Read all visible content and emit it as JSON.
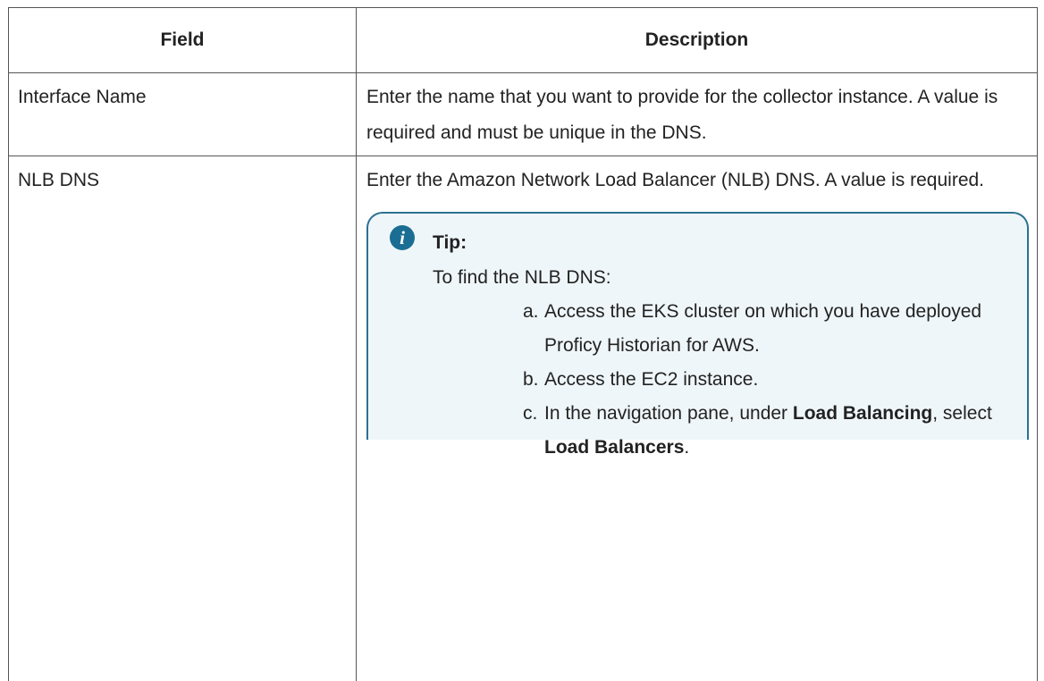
{
  "table": {
    "headers": {
      "field": "Field",
      "description": "Description"
    },
    "rows": [
      {
        "field": "Interface Name",
        "description": "Enter the name that you want to provide for the collector in­stance. A value is required and must be unique in the DNS."
      },
      {
        "field": "NLB DNS",
        "description": "Enter the Amazon Network Load Balancer (NLB) DNS. A value is required.",
        "tip": {
          "icon": "info-icon",
          "icon_glyph": "i",
          "title": "Tip:",
          "intro": "To find the NLB DNS:",
          "steps": [
            {
              "marker": "a.",
              "text": "Access the EKS cluster on which you have de­ployed Proficy Historian for AWS."
            },
            {
              "marker": "b.",
              "text": "Access the EC2 instance."
            },
            {
              "marker": "c.",
              "text_before": "In the navigation pane, under ",
              "bold_1": "Load Balancing",
              "text_middle": ", se­lect ",
              "bold_2": "Load Balancers",
              "text_after": "."
            }
          ]
        }
      }
    ]
  },
  "colors": {
    "tip_border": "#2c7191",
    "tip_background": "#eff6f9",
    "icon_background": "#1b6e93",
    "table_border": "#555555"
  }
}
